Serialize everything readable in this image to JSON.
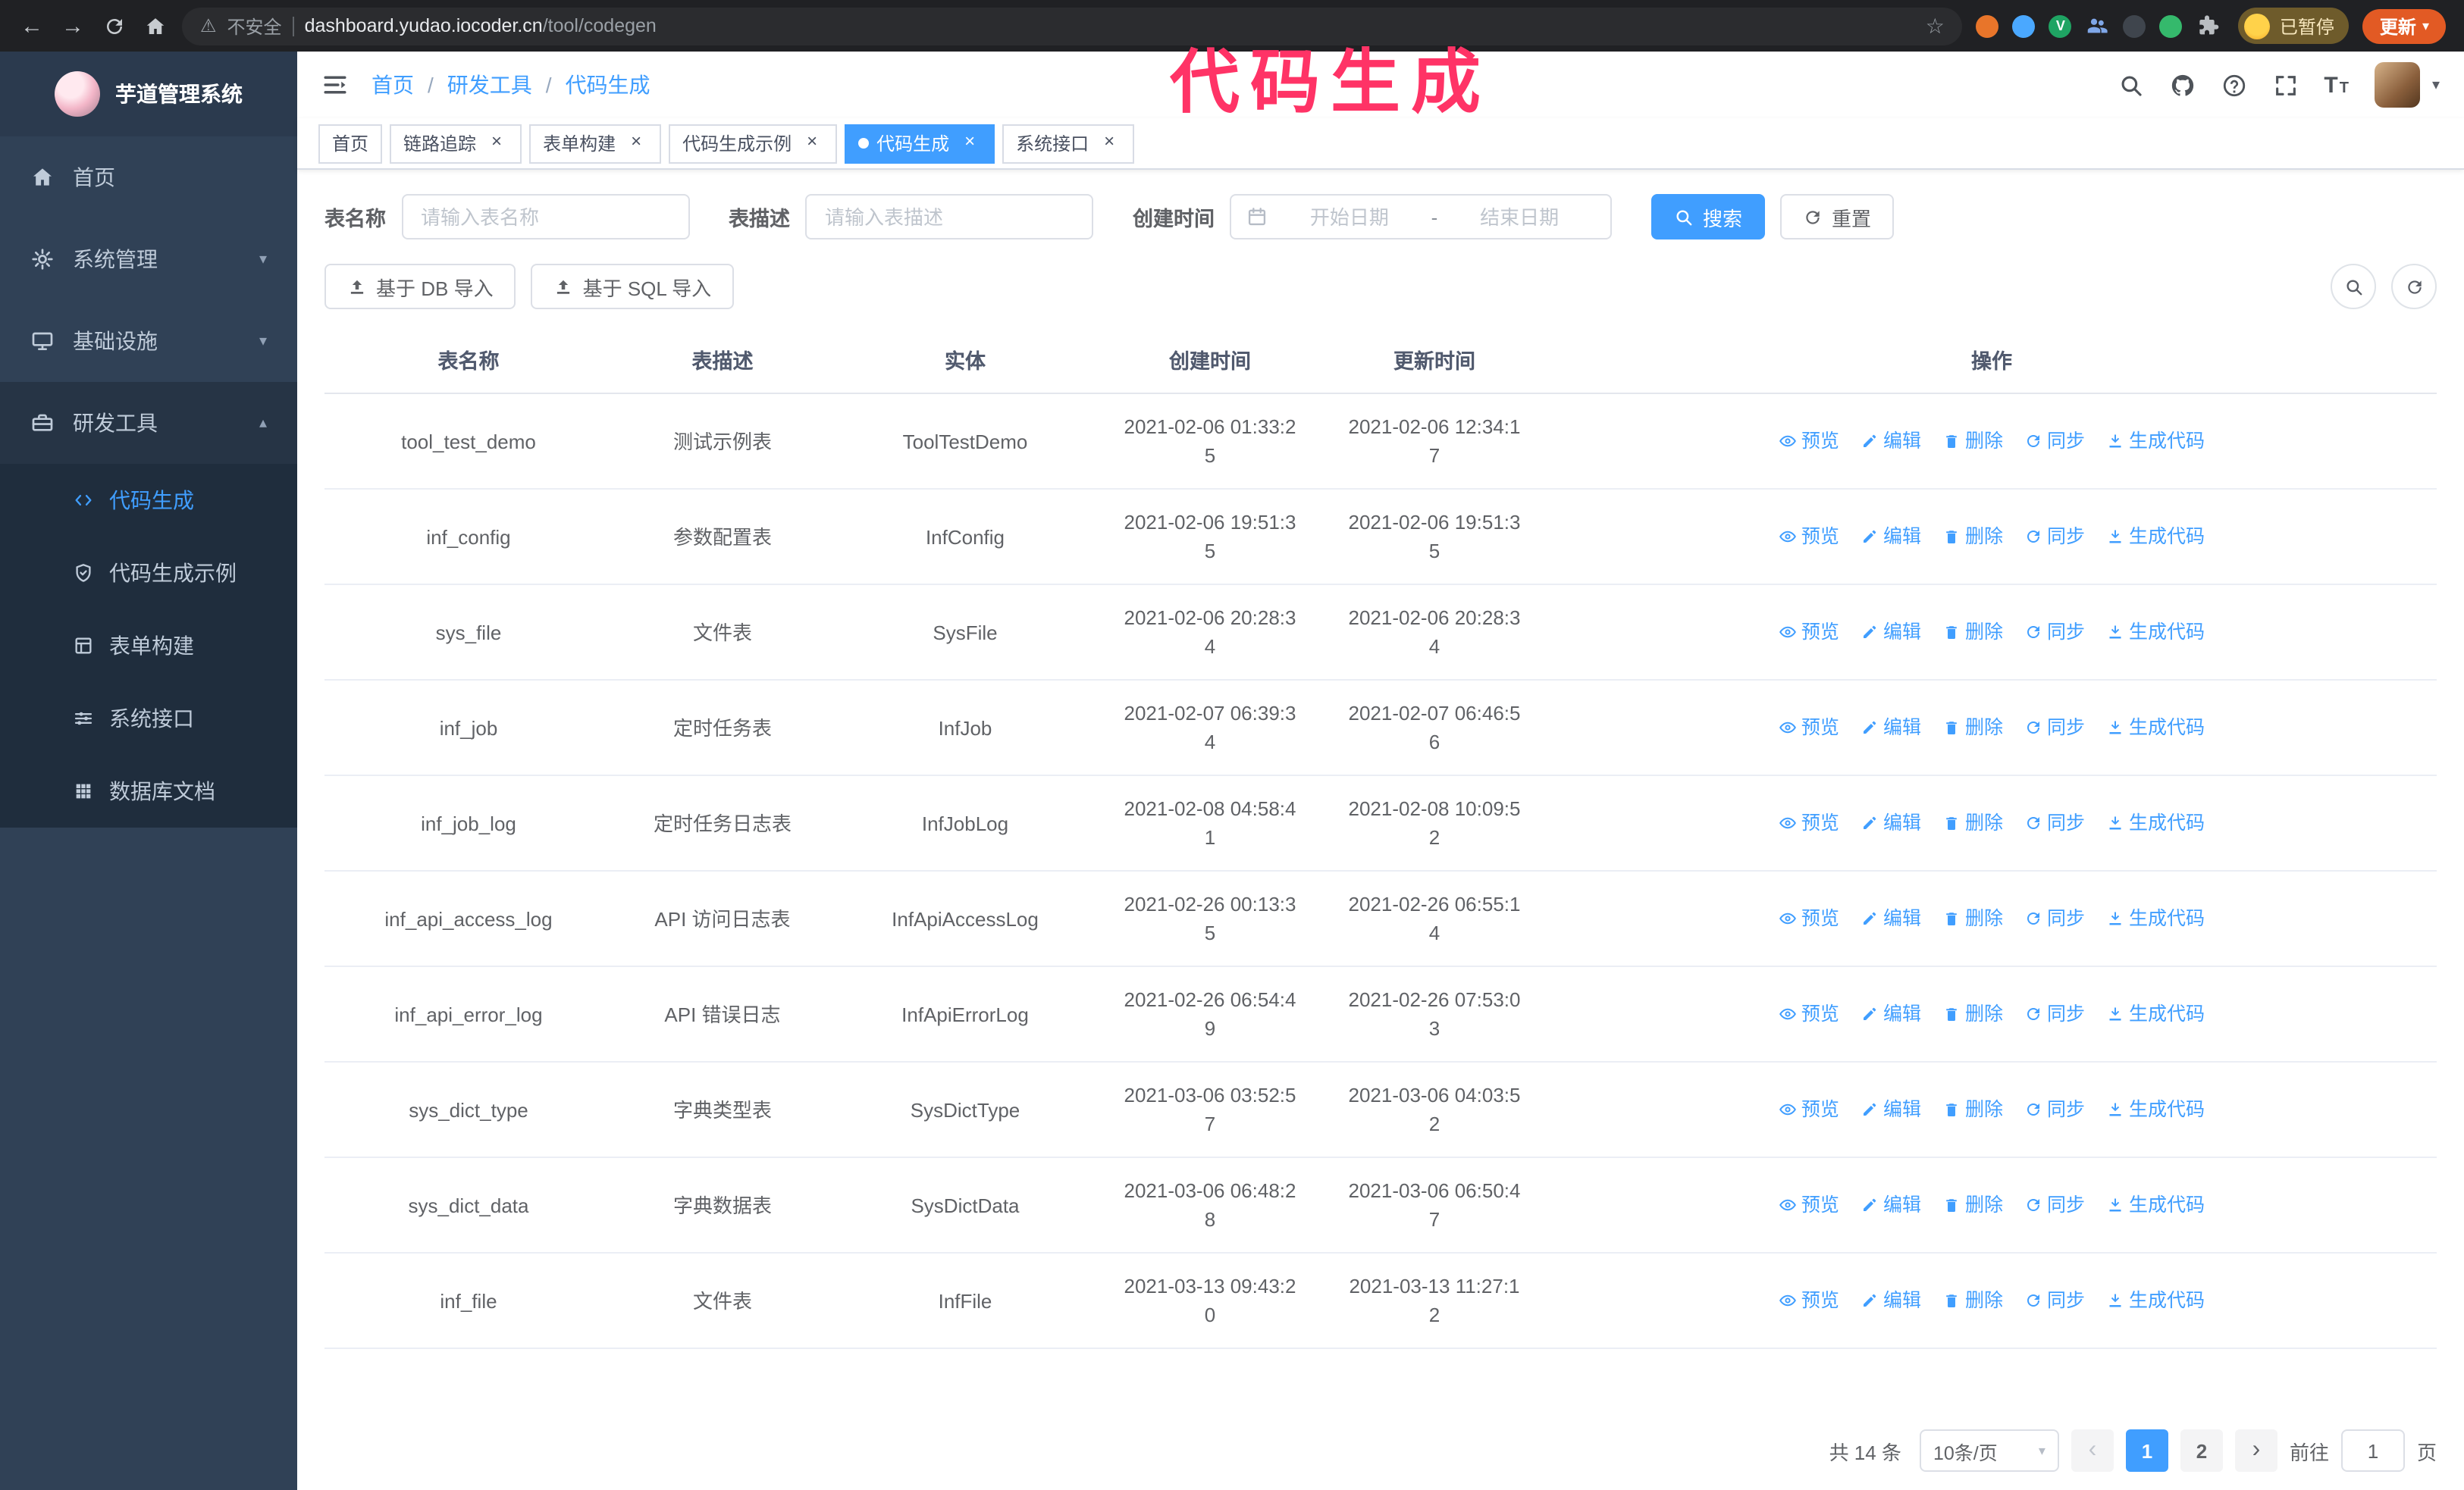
{
  "browser": {
    "security_label": "不安全",
    "url_host": "dashboard.yudao.iocoder.cn",
    "url_path": "/tool/codegen",
    "profile_badge": "已暂停",
    "update_button": "更新",
    "extensions": [
      {
        "name": "extension-icon",
        "color": "#e8752a"
      },
      {
        "name": "extension-icon",
        "color": "#4aa8ff"
      },
      {
        "name": "extension-icon",
        "color": "#1fa463",
        "glyph": "V"
      },
      {
        "name": "people-extension-icon",
        "color": "#7fa7e8",
        "icon": "people"
      },
      {
        "name": "extension-icon",
        "color": "#3f454d"
      },
      {
        "name": "extension-icon",
        "color": "#35b96c"
      },
      {
        "name": "puzzle-extension-icon",
        "color": "#b9bdc1",
        "icon": "puzzle"
      }
    ]
  },
  "overlay": {
    "title": "代码生成"
  },
  "glyphs": {
    "back": "←",
    "forward": "→",
    "star": "☆",
    "warning": "⚠",
    "caret_down": "▾",
    "caret_up": "▴",
    "close": "×",
    "prev": "‹",
    "next": "›",
    "slash": "/",
    "dash": "-",
    "font_size": "T"
  },
  "sidebar": {
    "logo_title": "芋道管理系统",
    "items": [
      {
        "id": "home",
        "icon": "home",
        "label": "首页"
      },
      {
        "id": "system-mgmt",
        "icon": "gear",
        "label": "系统管理",
        "chevron": "down"
      },
      {
        "id": "infrastructure",
        "icon": "infra",
        "label": "基础设施",
        "chevron": "down"
      },
      {
        "id": "dev-tools",
        "icon": "tools",
        "label": "研发工具",
        "chevron": "up",
        "expanded": true
      }
    ],
    "submenu": [
      {
        "id": "codegen",
        "icon": "code",
        "label": "代码生成",
        "active": true
      },
      {
        "id": "codegen-example",
        "icon": "shield",
        "label": "代码生成示例"
      },
      {
        "id": "form-builder",
        "icon": "form",
        "label": "表单构建"
      },
      {
        "id": "system-api",
        "icon": "sliders",
        "label": "系统接口"
      },
      {
        "id": "db-doc",
        "icon": "grid",
        "label": "数据库文档"
      }
    ]
  },
  "header": {
    "breadcrumb": [
      "首页",
      "研发工具",
      "代码生成"
    ]
  },
  "tabs": [
    {
      "id": "home",
      "label": "首页",
      "closable": false
    },
    {
      "id": "trace",
      "label": "链路追踪",
      "closable": true
    },
    {
      "id": "form-builder",
      "label": "表单构建",
      "closable": true
    },
    {
      "id": "codegen-example",
      "label": "代码生成示例",
      "closable": true
    },
    {
      "id": "codegen",
      "label": "代码生成",
      "closable": true,
      "active": true
    },
    {
      "id": "system-api",
      "label": "系统接口",
      "closable": true
    }
  ],
  "filters": {
    "table_name_label": "表名称",
    "table_name_placeholder": "请输入表名称",
    "table_desc_label": "表描述",
    "table_desc_placeholder": "请输入表描述",
    "create_time_label": "创建时间",
    "date_start_placeholder": "开始日期",
    "date_end_placeholder": "结束日期",
    "search_button": "搜索",
    "reset_button": "重置"
  },
  "toolbar": {
    "import_db_button": "基于 DB 导入",
    "import_sql_button": "基于 SQL 导入"
  },
  "table": {
    "columns": [
      "表名称",
      "表描述",
      "实体",
      "创建时间",
      "更新时间",
      "操作"
    ],
    "operations": [
      "预览",
      "编辑",
      "删除",
      "同步",
      "生成代码"
    ],
    "rows": [
      {
        "name": "tool_test_demo",
        "desc": "测试示例表",
        "entity": "ToolTestDemo",
        "created": "2021-02-06 01:33:25",
        "updated": "2021-02-06 12:34:17"
      },
      {
        "name": "inf_config",
        "desc": "参数配置表",
        "entity": "InfConfig",
        "created": "2021-02-06 19:51:35",
        "updated": "2021-02-06 19:51:35"
      },
      {
        "name": "sys_file",
        "desc": "文件表",
        "entity": "SysFile",
        "created": "2021-02-06 20:28:34",
        "updated": "2021-02-06 20:28:34"
      },
      {
        "name": "inf_job",
        "desc": "定时任务表",
        "entity": "InfJob",
        "created": "2021-02-07 06:39:34",
        "updated": "2021-02-07 06:46:56"
      },
      {
        "name": "inf_job_log",
        "desc": "定时任务日志表",
        "entity": "InfJobLog",
        "created": "2021-02-08 04:58:41",
        "updated": "2021-02-08 10:09:52"
      },
      {
        "name": "inf_api_access_log",
        "desc": "API 访问日志表",
        "entity": "InfApiAccessLog",
        "created": "2021-02-26 00:13:35",
        "updated": "2021-02-26 06:55:14"
      },
      {
        "name": "inf_api_error_log",
        "desc": "API 错误日志",
        "entity": "InfApiErrorLog",
        "created": "2021-02-26 06:54:49",
        "updated": "2021-02-26 07:53:03"
      },
      {
        "name": "sys_dict_type",
        "desc": "字典类型表",
        "entity": "SysDictType",
        "created": "2021-03-06 03:52:57",
        "updated": "2021-03-06 04:03:52"
      },
      {
        "name": "sys_dict_data",
        "desc": "字典数据表",
        "entity": "SysDictData",
        "created": "2021-03-06 06:48:28",
        "updated": "2021-03-06 06:50:47"
      },
      {
        "name": "inf_file",
        "desc": "文件表",
        "entity": "InfFile",
        "created": "2021-03-13 09:43:20",
        "updated": "2021-03-13 11:27:12"
      }
    ]
  },
  "pagination": {
    "total": "共 14 条",
    "page_size": "10条/页",
    "pages": [
      "1",
      "2"
    ],
    "active_page": "1",
    "goto_label": "前往",
    "goto_value": "1",
    "goto_suffix": "页"
  },
  "colors": {
    "accent": "#409eff",
    "sidebar_bg": "#304156",
    "submenu_bg": "#1f2d3d",
    "chrome_bg": "#202124",
    "overlay_title": "#ff3366",
    "update_button": "#e25a24"
  }
}
